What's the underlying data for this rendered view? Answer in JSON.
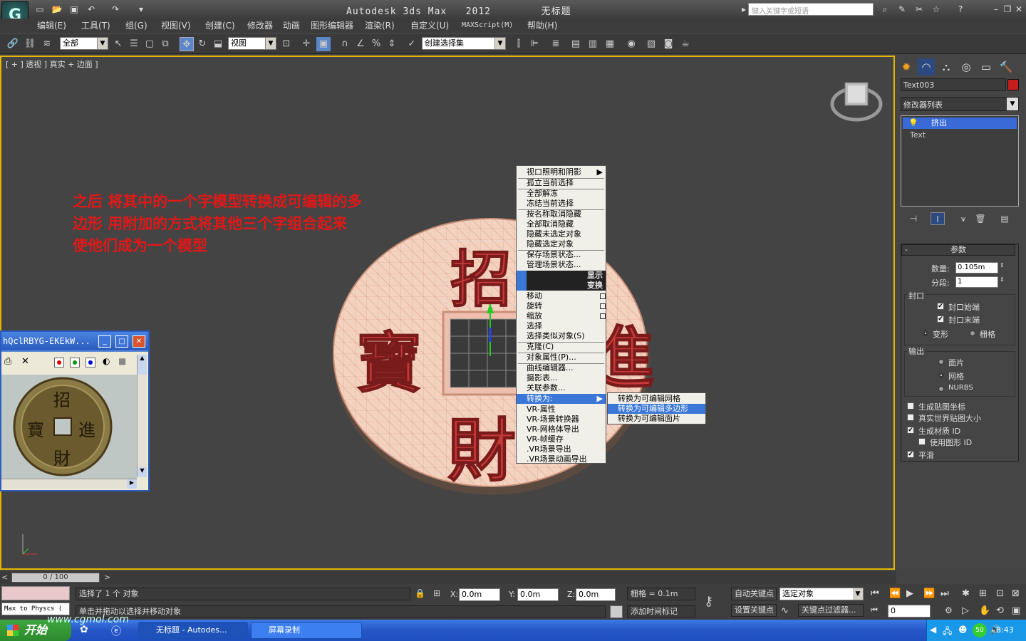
{
  "title_bar": {
    "app_title": "Autodesk 3ds Max   2012        无标题",
    "search_placeholder": "键入关键字或短语"
  },
  "menu": [
    "编辑(E)",
    "工具(T)",
    "组(G)",
    "视图(V)",
    "创建(C)",
    "修改器",
    "动画",
    "图形编辑器",
    "渲染(R)",
    "自定义(U)",
    "MAXScript(M)",
    "帮助(H)"
  ],
  "toolbar": {
    "selection_filter": "全部",
    "ref_coord": "视图",
    "named_selection": "创建选择集"
  },
  "viewport": {
    "label": "[ + ] 透视 ] 真实 + 边面 ]",
    "instruction": "之后 将其中的一个字模型转换成可编辑的多边形 用附加的方式将其他三个字组合起来 使他们成为一个模型",
    "coin_chars": [
      "招",
      "寶",
      "財",
      "進"
    ]
  },
  "context_menu": {
    "items": [
      {
        "label": "视口照明和阴影",
        "arrow": true
      },
      {
        "label": "孤立当前选择"
      },
      {
        "label": "全部解冻"
      },
      {
        "label": "冻结当前选择"
      },
      {
        "label": "按名称取消隐藏"
      },
      {
        "label": "全部取消隐藏"
      },
      {
        "label": "隐藏未选定对象"
      },
      {
        "label": "隐藏选定对象"
      },
      {
        "label": "保存场景状态..."
      },
      {
        "label": "管理场景状态..."
      }
    ],
    "header_display": "显示",
    "header_transform": "变换",
    "items2": [
      {
        "label": "移动"
      },
      {
        "label": "旋转"
      },
      {
        "label": "缩放"
      },
      {
        "label": "选择"
      },
      {
        "label": "选择类似对象(S)"
      },
      {
        "label": "克隆(C)"
      },
      {
        "label": "对象属性(P)..."
      },
      {
        "label": "曲线编辑器..."
      },
      {
        "label": "摄影表..."
      },
      {
        "label": "关联参数..."
      },
      {
        "label": "转换为:"
      },
      {
        "label": "VR-属性"
      },
      {
        "label": "VR-场景转换器"
      },
      {
        "label": "VR-网格体导出"
      },
      {
        "label": "VR-帧缓存"
      },
      {
        "label": ".VR场景导出"
      },
      {
        "label": ".VR场景动画导出"
      }
    ],
    "submenu": [
      "转换为可编辑网格",
      "转换为可编辑多边形",
      "转换为可编辑面片"
    ]
  },
  "floating_window": {
    "title": "hQclRBYG-EKEkW...",
    "coin_chars": [
      "招",
      "進",
      "財",
      "寶"
    ]
  },
  "command_panel": {
    "object_name": "Text003",
    "object_color": "#c41e1e",
    "modifier_list": "修改器列表",
    "stack": [
      "挤出",
      "Text"
    ],
    "params_title": "参数",
    "amount_label": "数量:",
    "amount_value": "0.105m",
    "segments_label": "分段:",
    "segments_value": "1",
    "capping_title": "封口",
    "cap_start": "封口始端",
    "cap_end": "封口末端",
    "morph": "变形",
    "grid": "栅格",
    "output_title": "输出",
    "patch": "面片",
    "mesh": "网格",
    "nurbs": "NURBS",
    "gen_map": "生成贴图坐标",
    "real_world": "真实世界贴图大小",
    "gen_mat": "生成材质 ID",
    "use_shape": "使用图形 ID",
    "smooth": "平滑"
  },
  "timeline": {
    "frame": "0 / 100"
  },
  "status": {
    "max_physx": "Max to Physcs (",
    "selected": "选择了 1 个 对象",
    "prompt": "单击并拖动以选择并移动对象",
    "x_label": "X:",
    "x_value": "0.0m",
    "y_label": "Y:",
    "y_value": "0.0m",
    "z_label": "Z:",
    "z_value": "0.0m",
    "grid": "栅格 = 0.1m",
    "add_tag": "添加时间标记",
    "auto_key": "自动关键点",
    "set_key": "设置关键点",
    "key_mode": "选定对象",
    "key_filter": "关键点过滤器...",
    "frame_value": "0"
  },
  "taskbar": {
    "start": "开始",
    "task1": "无标题 - Autodes...",
    "task2": "屏幕录制",
    "clock": "8:43",
    "watermark": "www.cgmol.com"
  }
}
